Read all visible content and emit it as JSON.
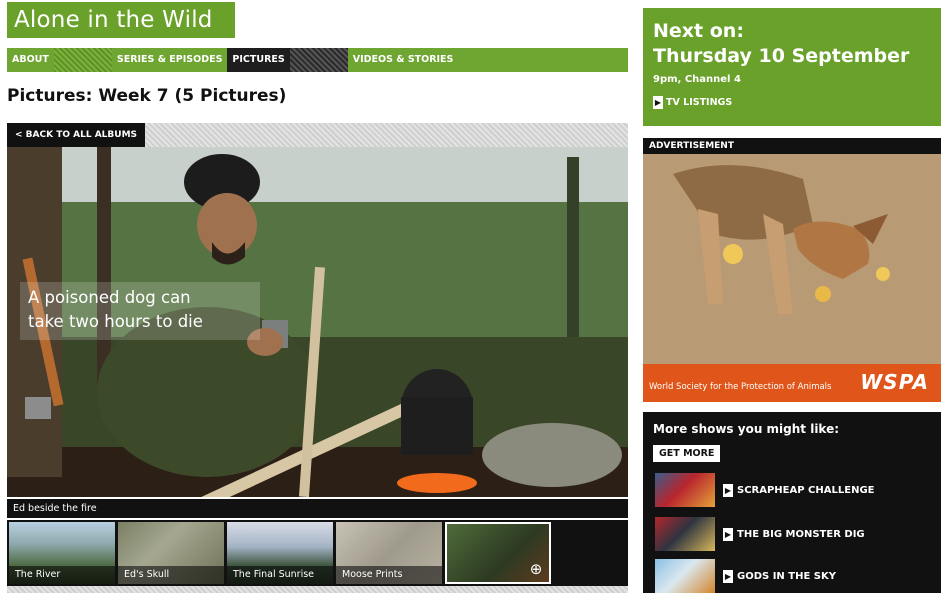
{
  "brand": {
    "title": "Alone in the Wild"
  },
  "nav": {
    "items": [
      {
        "label": "ABOUT"
      },
      {
        "label": "SERIES & EPISODES"
      },
      {
        "label": "PICTURES"
      },
      {
        "label": "VIDEOS & STORIES"
      }
    ],
    "active": "PICTURES"
  },
  "gallery": {
    "heading": "Pictures: Week 7 (5 Pictures)",
    "back_label": "< BACK TO ALL ALBUMS",
    "caption": "Ed beside the fire",
    "thumbnails": [
      {
        "label": "The River"
      },
      {
        "label": "Ed's Skull"
      },
      {
        "label": "The Final Sunrise"
      },
      {
        "label": "Moose Prints"
      },
      {
        "label": ""
      }
    ],
    "zoom_icon": "magnify-plus-icon"
  },
  "next_on": {
    "line1": "Next on:",
    "date": "Thursday 10 September",
    "time_channel": "9pm, Channel 4",
    "listings_label": "TV LISTINGS"
  },
  "advertisement": {
    "header": "ADVERTISEMENT",
    "text_line1": "A poisoned dog can",
    "text_line2": "take two hours to die",
    "org": "World Society for the Protection of Animals",
    "logo": "WSPA"
  },
  "more_shows": {
    "title": "More shows you might like:",
    "get_more_label": "GET MORE",
    "items": [
      {
        "label": "SCRAPHEAP CHALLENGE"
      },
      {
        "label": "THE BIG MONSTER DIG"
      },
      {
        "label": "GODS IN THE SKY"
      }
    ]
  },
  "colors": {
    "brand_green": "#6aa12b",
    "black": "#111111",
    "ad_orange": "#e0561a"
  }
}
